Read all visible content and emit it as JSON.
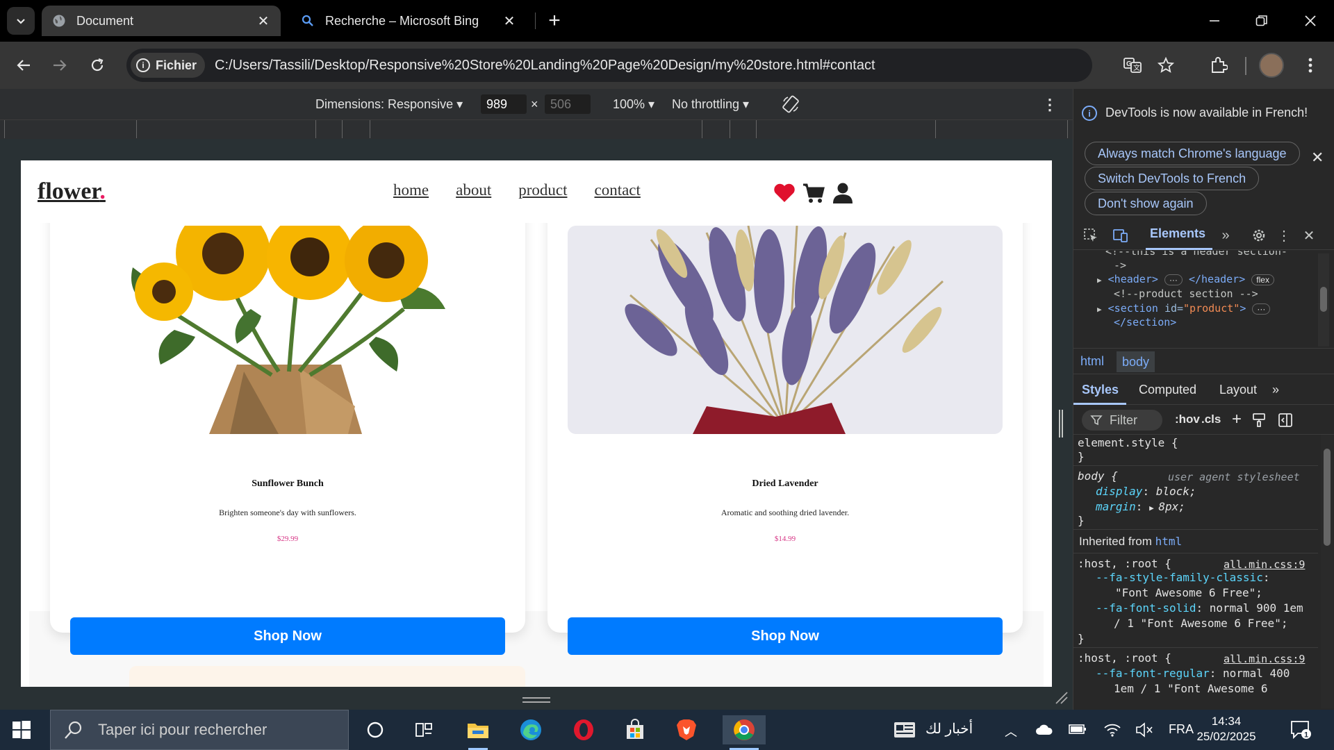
{
  "browser": {
    "tabs": [
      {
        "title": "Document",
        "active": true
      },
      {
        "title": "Recherche – Microsoft Bing",
        "active": false
      }
    ],
    "site_chip": "Fichier",
    "url": "C:/Users/Tassili/Desktop/Responsive%20Store%20Landing%20Page%20Design/my%20store.html#contact"
  },
  "device_toolbar": {
    "dimensions_label": "Dimensions: Responsive ▾",
    "width": "989",
    "times": "×",
    "height": "506",
    "zoom": "100% ▾",
    "throttling": "No throttling ▾"
  },
  "site": {
    "logo": "flower",
    "logo_dot": ".",
    "nav": [
      "home",
      "about",
      "product",
      "contact"
    ],
    "accent_price_color": "#d63384",
    "button_color": "#007bff",
    "products": [
      {
        "name": "Sunflower Bunch",
        "description": "Brighten someone's day with sunflowers.",
        "price": "$29.99",
        "button": "Shop Now"
      },
      {
        "name": "Dried Lavender",
        "description": "Aromatic and soothing dried lavender.",
        "price": "$14.99",
        "button": "Shop Now"
      }
    ]
  },
  "devtools": {
    "notice": "DevTools is now available in French!",
    "notice_buttons": [
      "Always match Chrome's language",
      "Switch DevTools to French",
      "Don't show again"
    ],
    "main_tab": "Elements",
    "dom": {
      "comment1": "<!--this is a header section-",
      "comment1b": "->",
      "header_open": "<header>",
      "header_close": "</header>",
      "header_badge": "flex",
      "comment2": "<!--product section -->",
      "section_open": "<section",
      "section_attr": "id=",
      "section_val": "\"product\"",
      "section_gt": ">",
      "section_close": "</section>"
    },
    "breadcrumbs": [
      "html",
      "body"
    ],
    "subtabs": [
      "Styles",
      "Computed",
      "Layout"
    ],
    "filter_placeholder": "Filter",
    "filter_tools": [
      ":hov",
      ".cls"
    ],
    "styles": {
      "element_style": "element.style {",
      "close": "}",
      "body_sel": "body {",
      "ua_label": "user agent stylesheet",
      "display_prop": "display",
      "display_val": "block;",
      "margin_prop": "margin",
      "margin_val": "8px;",
      "inherited_label": "Inherited from",
      "inherited_from": "html",
      "rule1_sel": ":host, :root {",
      "rule1_src": "all.min.css:9",
      "fa_family_prop": "--fa-style-family-classic",
      "fa_family_val": "\"Font Awesome 6 Free\";",
      "fa_solid_prop": "--fa-font-solid",
      "fa_solid_val": "normal 900 1em",
      "fa_solid_val2": "/ 1 \"Font Awesome 6 Free\";",
      "rule2_sel": ":host, :root {",
      "rule2_src": "all.min.css:9",
      "fa_regular_prop": "--fa-font-regular",
      "fa_regular_val": "normal 400",
      "fa_regular_val2": "1em / 1 \"Font Awesome 6"
    }
  },
  "taskbar": {
    "search_placeholder": "Taper ici pour rechercher",
    "news": "أخبار لك",
    "language": "FRA",
    "time": "14:34",
    "date": "25/02/2025",
    "notification_count": "1"
  }
}
